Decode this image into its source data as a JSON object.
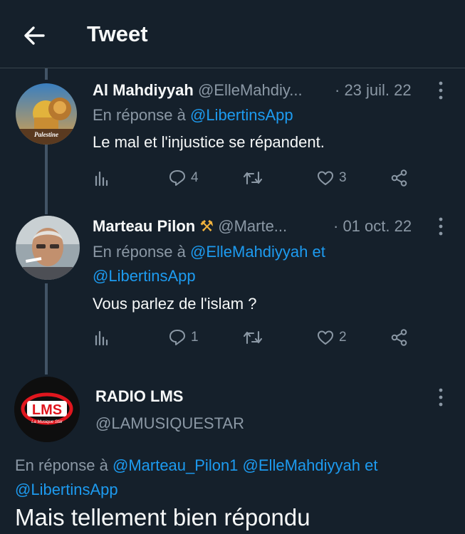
{
  "header": {
    "title": "Tweet"
  },
  "tweets": [
    {
      "name": "Al Mahdiyyah",
      "handle": "@ElleMahdiy...",
      "date": "· 23 juil. 22",
      "reply_prefix": "En réponse à ",
      "reply_line1_links": "@LibertinsApp",
      "reply_line1_suffix": "",
      "reply_line2": "",
      "text": "Le mal et l'injustice se répandent.",
      "replies": "4",
      "retweets": "",
      "likes": "3",
      "avatar_caption": "Palestine"
    },
    {
      "name": "Marteau Pilon",
      "name_emoji": "⚒",
      "handle": "@Marte...",
      "date": "· 01 oct. 22",
      "reply_prefix": "En réponse à ",
      "reply_line1_links": "@ElleMahdiyyah",
      "reply_line1_suffix": " et",
      "reply_line2": "@LibertinsApp",
      "text": "Vous parlez de l'islam ?",
      "replies": "1",
      "retweets": "",
      "likes": "2"
    }
  ],
  "main_tweet": {
    "name": "RADIO LMS",
    "handle": "@LAMUSIQUESTAR",
    "logo_text": "LMS",
    "logo_sub": "La Musique Star",
    "reply_prefix": "En réponse à ",
    "reply_link1": "@Marteau_Pilon1",
    "reply_link2": "@ElleMahdiyyah",
    "reply_and": " et",
    "reply_link3": "@LibertinsApp",
    "text": "Mais tellement bien répondu"
  },
  "colors": {
    "background": "#15202b",
    "link": "#1d9bf0",
    "muted": "#8b98a5",
    "logo_red": "#e0161e"
  }
}
